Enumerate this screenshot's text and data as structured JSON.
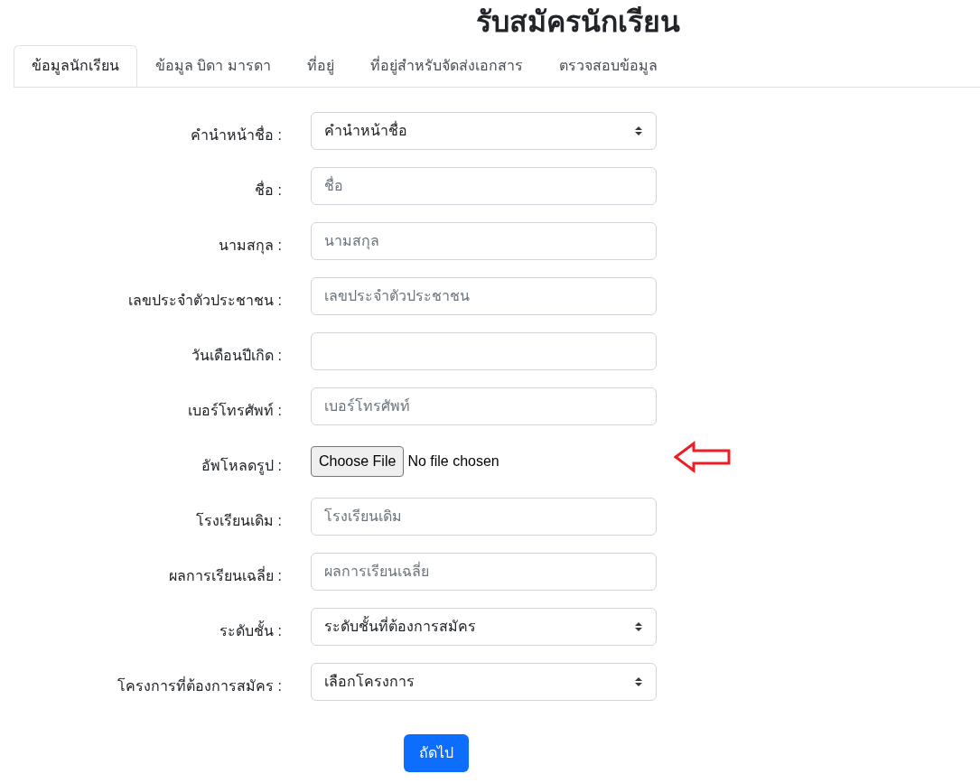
{
  "title": "รับสมัครนักเรียน",
  "tabs": [
    {
      "label": "ข้อมูลนักเรียน",
      "selected": true
    },
    {
      "label": "ข้อมูล บิดา มารดา",
      "selected": false
    },
    {
      "label": "ที่อยู่",
      "selected": false
    },
    {
      "label": "ที่อยู่สำหรับจัดส่งเอกสาร",
      "selected": false
    },
    {
      "label": "ตรวจสอบข้อมูล",
      "selected": false
    }
  ],
  "fields": [
    {
      "kind": "select",
      "label": "คำนำหน้าชื่อ :",
      "value": "คำนำหน้าชื่อ"
    },
    {
      "kind": "input",
      "label": "ชื่อ :",
      "placeholder": "ชื่อ"
    },
    {
      "kind": "input",
      "label": "นามสกุล :",
      "placeholder": "นามสกุล"
    },
    {
      "kind": "input",
      "label": "เลขประจำตัวประชาชน :",
      "placeholder": "เลขประจำตัวประชาชน"
    },
    {
      "kind": "date",
      "label": "วันเดือนปีเกิด :"
    },
    {
      "kind": "input",
      "label": "เบอร์โทรศัพท์ :",
      "placeholder": "เบอร์โทรศัพท์"
    },
    {
      "kind": "file",
      "label": "อัพโหลดรูป :",
      "button_label": "Choose File",
      "status": "No file chosen"
    },
    {
      "kind": "input",
      "label": "โรงเรียนเดิม :",
      "placeholder": "โรงเรียนเดิม"
    },
    {
      "kind": "input",
      "label": "ผลการเรียนเฉลี่ย :",
      "placeholder": "ผลการเรียนเฉลี่ย"
    },
    {
      "kind": "select",
      "label": "ระดับชั้น :",
      "value": "ระดับชั้นที่ต้องการสมัคร"
    },
    {
      "kind": "select",
      "label": "โครงการที่ต้องการสมัคร :",
      "value": "เลือกโครงการ"
    }
  ],
  "next_button": "ถัดไป"
}
